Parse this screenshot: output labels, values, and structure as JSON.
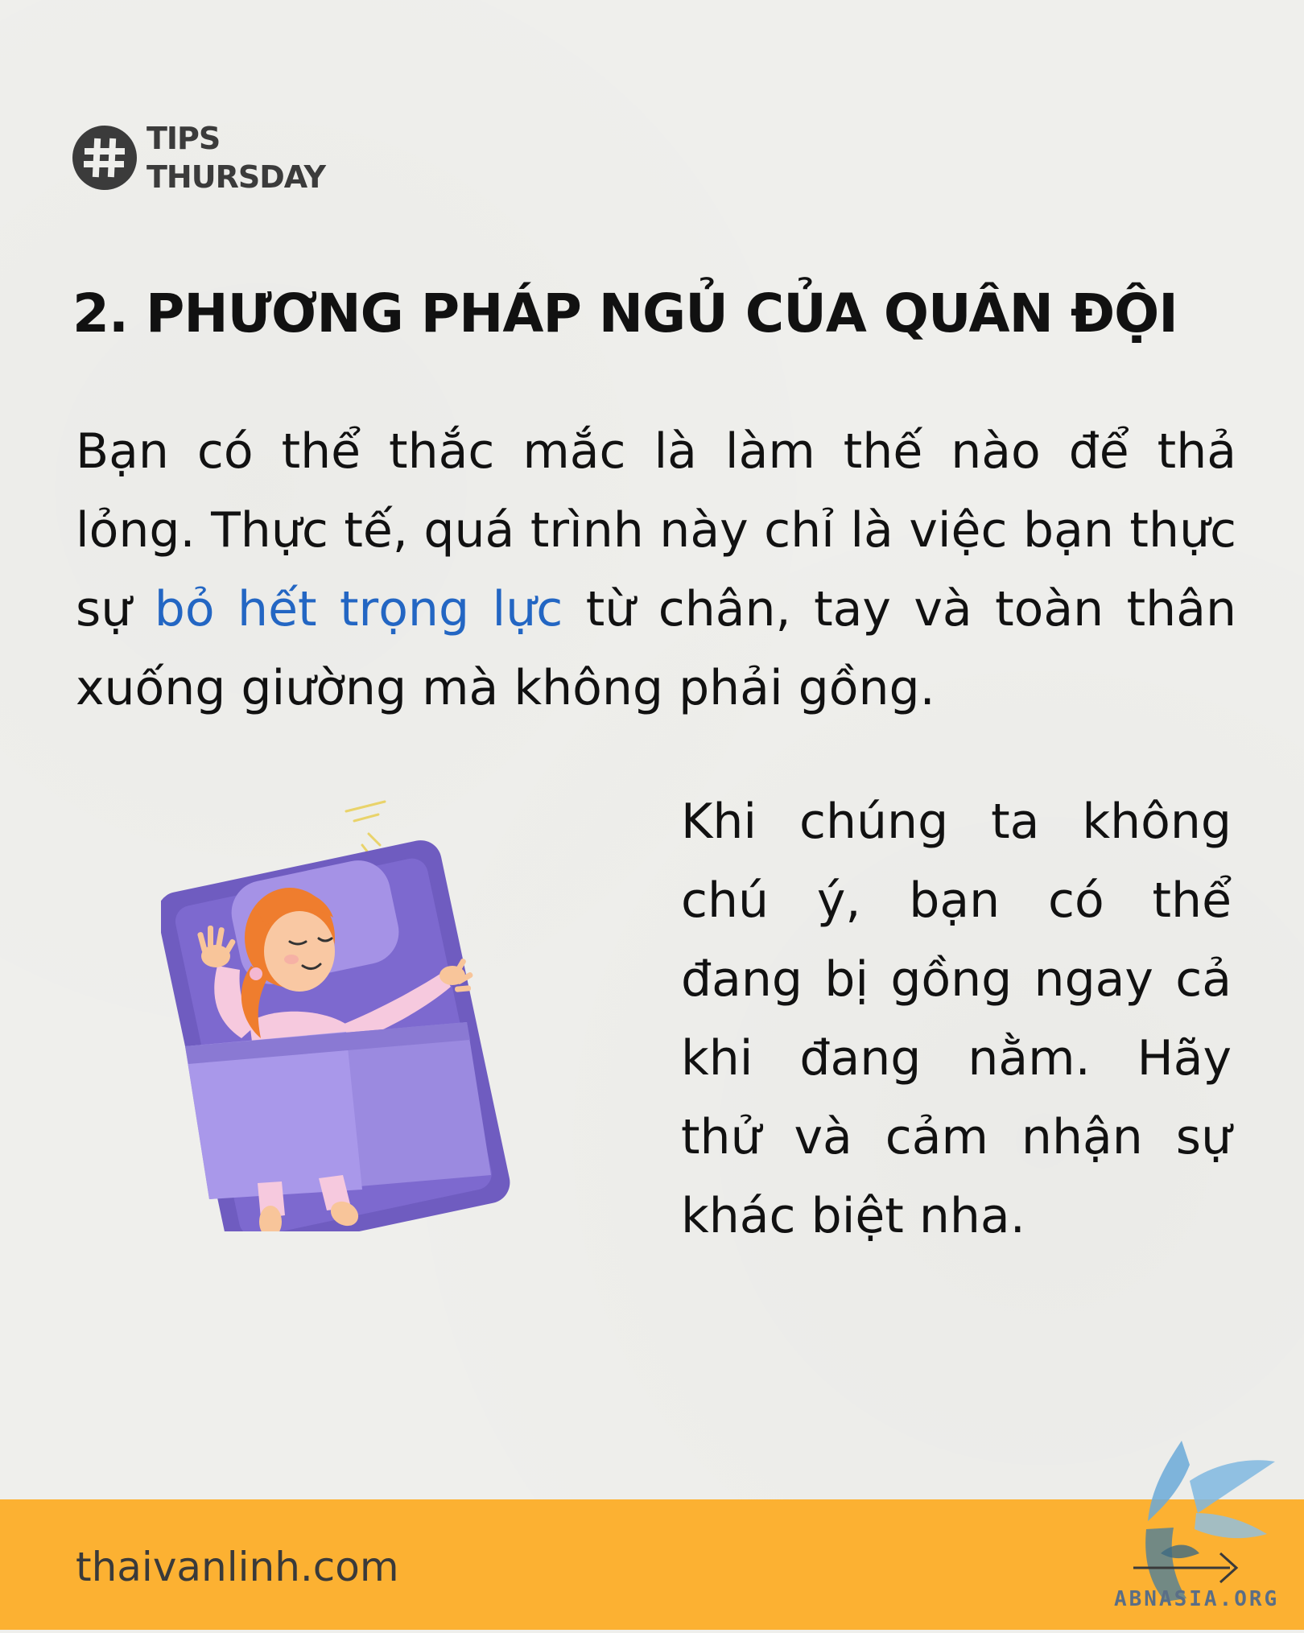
{
  "badge": {
    "line1": "TIPS",
    "line2": "THURSDAY"
  },
  "title": "2. PHƯƠNG PHÁP NGỦ CỦA QUÂN ĐỘI",
  "intro": {
    "part1": "Bạn có thể thắc mắc là làm thế nào để thả lỏng. Thực tế, quá trình này chỉ là việc bạn thực sự ",
    "highlight": "bỏ hết trọng lực",
    "part2": " từ chân, tay và toàn thân xuống giường mà không phải gồng."
  },
  "side_text": "Khi chúng ta không chú ý, bạn có thể đang bị gồng ngay cả khi đang nằm. Hãy thử và cảm nhận sự khác biệt nha.",
  "footer": {
    "website": "thaivanlinh.com",
    "logo_text": "ABNASIA.ORG"
  },
  "colors": {
    "background": "#efefec",
    "footer": "#fcb132",
    "highlight": "#2366c3",
    "badge": "#3b3b3b"
  },
  "icons": {
    "badge": "hash-icon",
    "illustration": "sleeping-girl-illustration",
    "logo": "bird-logo-icon"
  }
}
